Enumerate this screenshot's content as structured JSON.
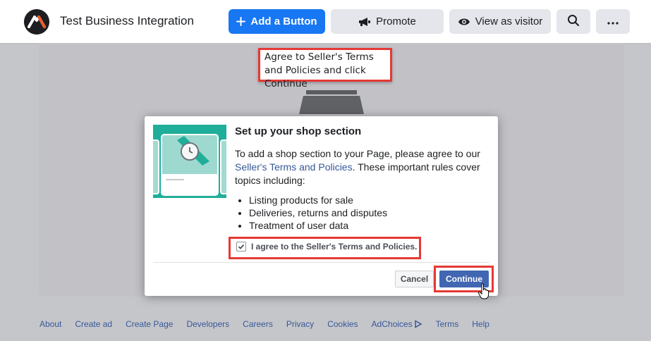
{
  "header": {
    "page_name": "Test Business Integration",
    "logo_icon": "business-logo-icon",
    "buttons": {
      "add": "Add a Button",
      "promote": "Promote",
      "view_as_visitor": "View as visitor"
    },
    "icons": [
      "plus-icon",
      "megaphone-icon",
      "eye-icon",
      "search-icon",
      "more-icon"
    ]
  },
  "callout": {
    "text": "Agree to Seller's Terms and Policies and click Continue"
  },
  "dialog": {
    "title": "Set up your shop section",
    "body_prefix": "To add a shop section to your Page, please agree to our ",
    "link": "Seller's Terms and Policies",
    "body_suffix": ". These important rules cover topics including:",
    "bullets": [
      "Listing products for sale",
      "Deliveries, returns and disputes",
      "Treatment of user data"
    ],
    "agree_label": "I agree to the Seller's Terms and Policies.",
    "agree_checked": true,
    "cancel": "Cancel",
    "continue": "Continue"
  },
  "footer": {
    "links": [
      "About",
      "Create ad",
      "Create Page",
      "Developers",
      "Careers",
      "Privacy",
      "Cookies",
      "AdChoices",
      "Terms",
      "Help"
    ]
  },
  "colors": {
    "primary": "#1877f2",
    "continue": "#4267b2",
    "highlight": "#e53935",
    "illustration": "#1fae99"
  }
}
